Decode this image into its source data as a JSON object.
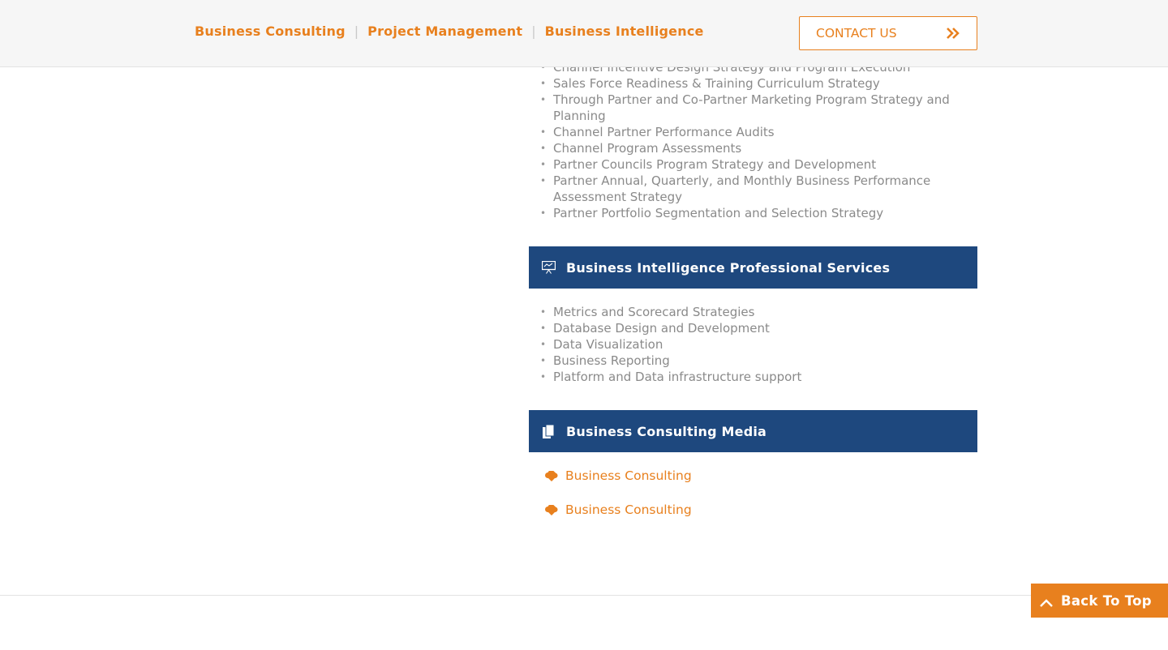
{
  "header": {
    "nav": [
      "Business Consulting",
      "Project Management",
      "Business Intelligence"
    ],
    "separator": "|",
    "contact_label": "CONTACT US"
  },
  "channel_list": [
    "Channel Incentive Design Strategy and Program Execution",
    "Sales Force Readiness & Training Curriculum Strategy",
    "Through Partner and Co-Partner Marketing Program Strategy and Planning",
    "Channel Partner Performance Audits",
    "Channel Program Assessments",
    "Partner Councils Program Strategy and Development",
    "Partner Annual, Quarterly, and Monthly Business Performance Assessment Strategy",
    "Partner Portfolio Segmentation and Selection Strategy"
  ],
  "bi_section": {
    "title": "Business Intelligence Professional Services",
    "icon": "presentation-icon",
    "items": [
      "Metrics and Scorecard Strategies",
      "Database Design and Development",
      "Data Visualization",
      "Business Reporting",
      "Platform and Data infrastructure support"
    ]
  },
  "media_section": {
    "title": "Business Consulting Media",
    "icon": "document-icon",
    "links": [
      "Business Consulting",
      "Business Consulting"
    ],
    "link_icon": "cloud-download-icon"
  },
  "back_to_top": "Back To Top",
  "colors": {
    "accent": "#e8801e",
    "header_bar": "#1e487e",
    "text": "#8a8a8a"
  }
}
